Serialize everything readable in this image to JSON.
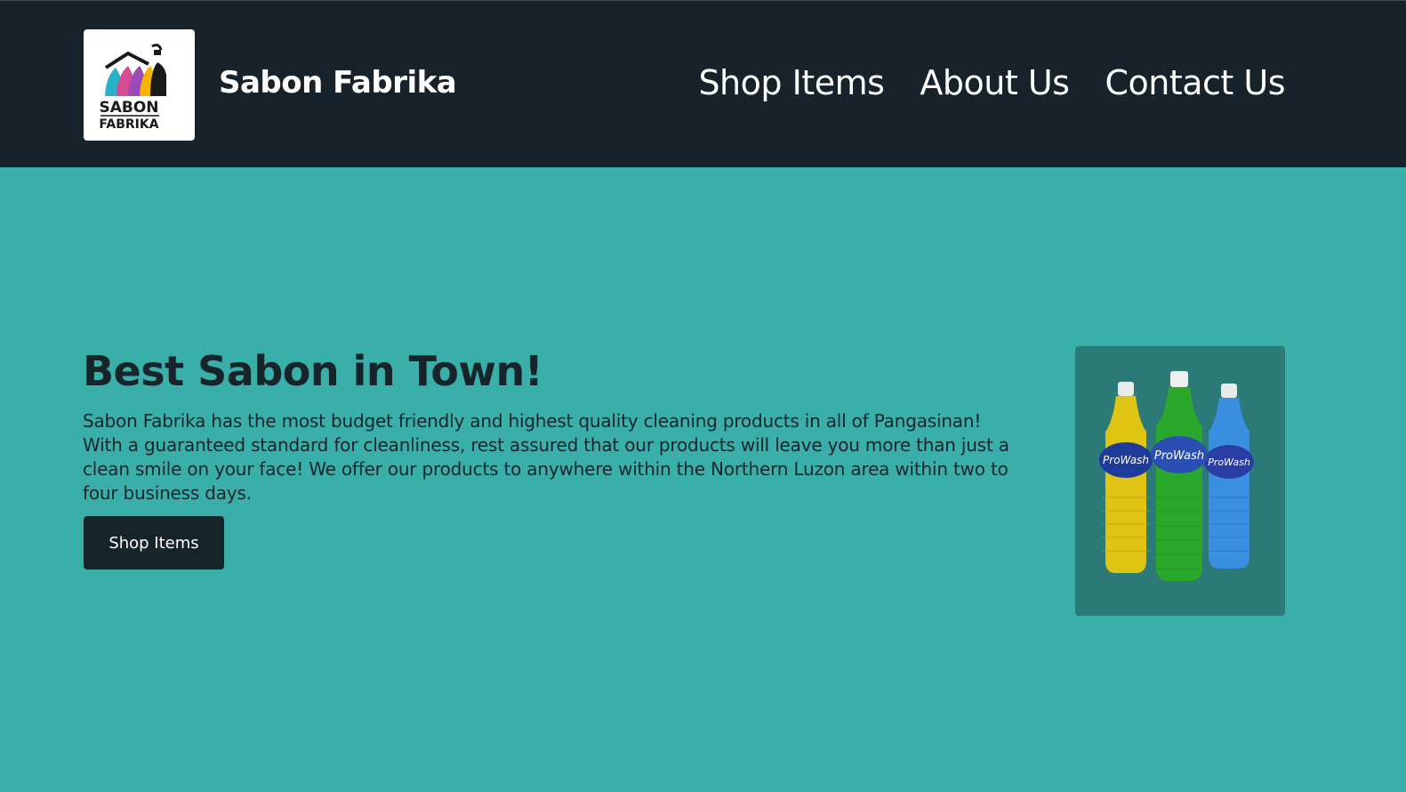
{
  "header": {
    "brand": "Sabon Fabrika",
    "logo_text": [
      "SABON",
      "FABRIKA"
    ],
    "nav": [
      "Shop Items",
      "About Us",
      "Contact Us"
    ]
  },
  "hero": {
    "title": "Best Sabon in Town!",
    "text": "Sabon Fabrika has the most budget friendly and highest quality cleaning products in all of Pangasinan! With a guaranteed standard for cleanliness, rest assured that our products will leave you more than just a clean smile on your face! We offer our products to anywhere within the Northern Luzon area within two to four business days.",
    "button": "Shop Items"
  },
  "product": {
    "label": "ProWash",
    "bottle_colors": [
      "#e0c414",
      "#2aa82c",
      "#3b8fe0"
    ]
  },
  "colors": {
    "header_bg": "#17222a",
    "page_bg": "#3aafa9",
    "dark": "#17252a",
    "card_bg": "#2b7a78"
  }
}
